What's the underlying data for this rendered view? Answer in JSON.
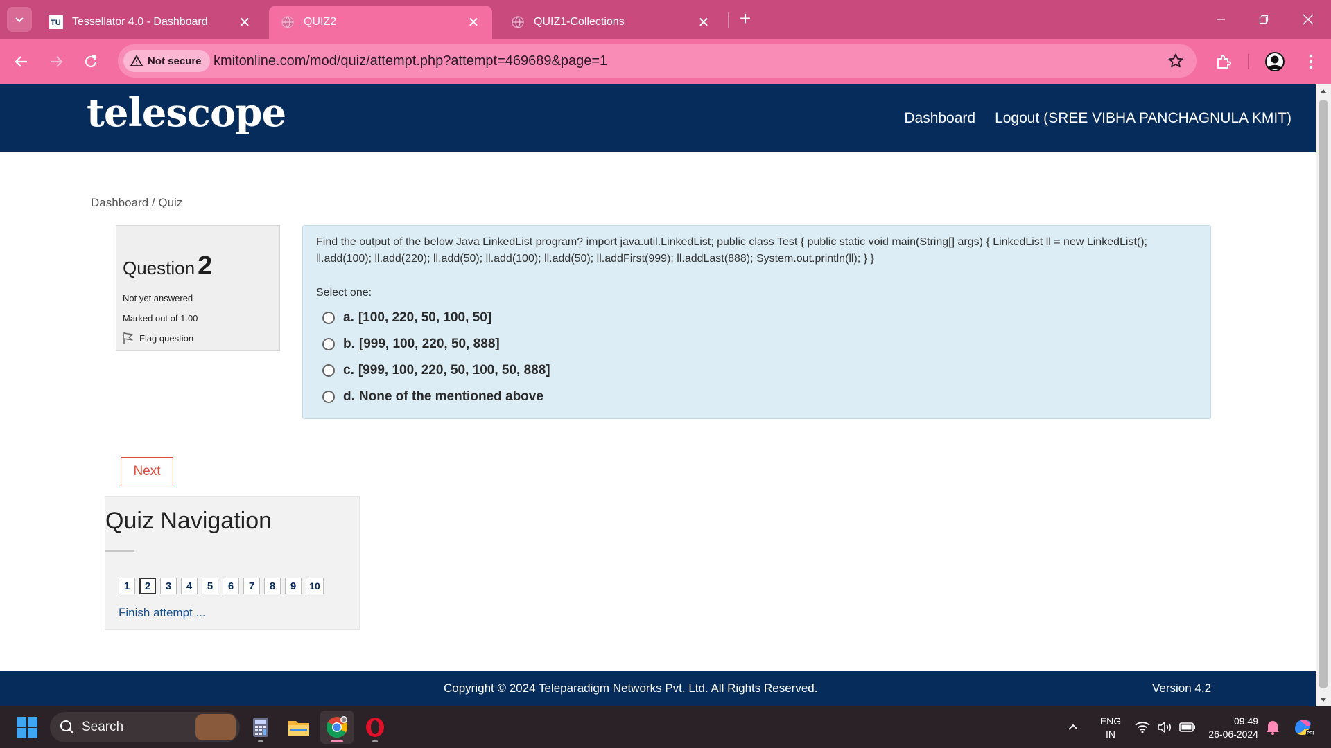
{
  "browser": {
    "tabs": [
      {
        "title": "Tessellator 4.0 - Dashboard",
        "favicon": "tessellator-logo",
        "active": false
      },
      {
        "title": "QUIZ2",
        "favicon": "globe-icon",
        "active": true
      },
      {
        "title": "QUIZ1-Collections",
        "favicon": "globe-icon",
        "active": false
      }
    ],
    "security_label": "Not secure",
    "url": "kmitonline.com/mod/quiz/attempt.php?attempt=469689&page=1"
  },
  "site": {
    "logo": "telescope",
    "nav": {
      "dashboard": "Dashboard",
      "logout": "Logout (SREE VIBHA PANCHAGNULA KMIT)"
    },
    "breadcrumb": {
      "home": "Dashboard",
      "separator": " / ",
      "current": "Quiz"
    }
  },
  "question": {
    "label": "Question",
    "number": "2",
    "state": "Not yet answered",
    "grade": "Marked out of 1.00",
    "flag_label": "Flag question",
    "text": "Find the output of the below Java LinkedList program? import java.util.LinkedList; public class Test { public static void main(String[] args) { LinkedList ll = new LinkedList(); ll.add(100); ll.add(220); ll.add(50); ll.add(100); ll.add(50); ll.addFirst(999); ll.addLast(888); System.out.println(ll); } }",
    "prompt": "Select one:",
    "answers": [
      {
        "letter": "a.",
        "text": "[100, 220, 50, 100, 50]"
      },
      {
        "letter": "b.",
        "text": "[999, 100, 220, 50, 888]"
      },
      {
        "letter": "c.",
        "text": "[999, 100, 220, 50, 100, 50, 888]"
      },
      {
        "letter": "d.",
        "text": "None of the mentioned above"
      }
    ]
  },
  "next_label": "Next",
  "quiz_nav": {
    "heading": "Quiz Navigation",
    "questions": [
      "1",
      "2",
      "3",
      "4",
      "5",
      "6",
      "7",
      "8",
      "9",
      "10"
    ],
    "current_index": 1,
    "finish_label": "Finish attempt ..."
  },
  "footer": {
    "copyright": "Copyright © 2024 Teleparadigm Networks Pvt. Ltd. All Rights Reserved.",
    "version": "Version 4.2"
  },
  "taskbar": {
    "search_label": "Search",
    "lang_top": "ENG",
    "lang_bottom": "IN",
    "time": "09:49",
    "date": "26-06-2024"
  },
  "colors": {
    "tab_strip": "#c94b7e",
    "toolbar": "#f46ea2",
    "header_navy": "#062c5c",
    "question_bg": "#dcedf6",
    "next_red": "#e04b3c"
  }
}
